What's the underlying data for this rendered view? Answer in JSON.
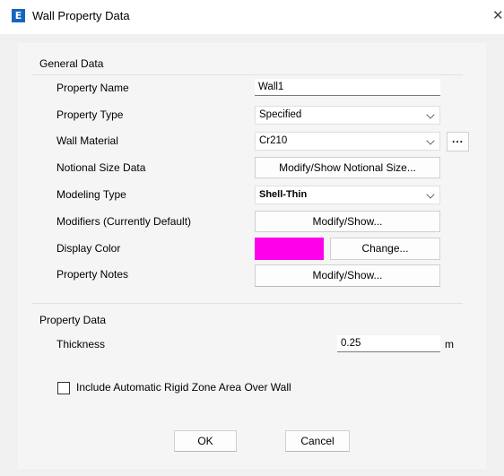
{
  "window": {
    "title": "Wall Property Data",
    "app_icon": "E",
    "close_glyph": "✕"
  },
  "general": {
    "header": "General Data",
    "property_name": {
      "label": "Property Name",
      "value": "Wall1"
    },
    "property_type": {
      "label": "Property Type",
      "value": "Specified"
    },
    "wall_material": {
      "label": "Wall Material",
      "value": "Cr210",
      "ellipsis": "..."
    },
    "notional_size": {
      "label": "Notional Size Data",
      "button": "Modify/Show Notional Size..."
    },
    "modeling_type": {
      "label": "Modeling Type",
      "value": "Shell-Thin"
    },
    "modifiers": {
      "label": "Modifiers (Currently Default)",
      "button": "Modify/Show..."
    },
    "display_color": {
      "label": "Display Color",
      "color": "#ff00ea",
      "button": "Change..."
    },
    "notes": {
      "label": "Property Notes",
      "button": "Modify/Show..."
    }
  },
  "property_data": {
    "header": "Property Data",
    "thickness": {
      "label": "Thickness",
      "value": "0.25",
      "unit": "m"
    },
    "rigid_zone": {
      "label": "Include Automatic Rigid Zone Area Over Wall",
      "checked": false
    }
  },
  "buttons": {
    "ok": "OK",
    "cancel": "Cancel"
  }
}
